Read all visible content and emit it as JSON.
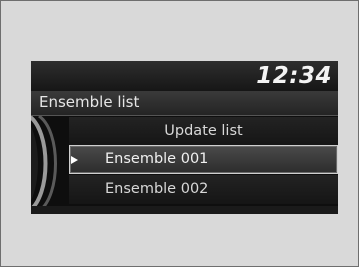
{
  "header": {
    "clock": "12:34"
  },
  "screen": {
    "title": "Ensemble list"
  },
  "menu": {
    "items": [
      {
        "label": "Update list"
      },
      {
        "label": "Ensemble 001",
        "selected": true
      },
      {
        "label": "Ensemble 002"
      }
    ]
  },
  "icons": {
    "selector": "pointer-arrow-icon",
    "dial": "selector-knob-icon"
  },
  "colors": {
    "frame_bg": "#d9d9d9",
    "screen_bg": "#0e0e0e",
    "highlight_border": "#cfcfcf",
    "text": "#d8d8d8"
  }
}
